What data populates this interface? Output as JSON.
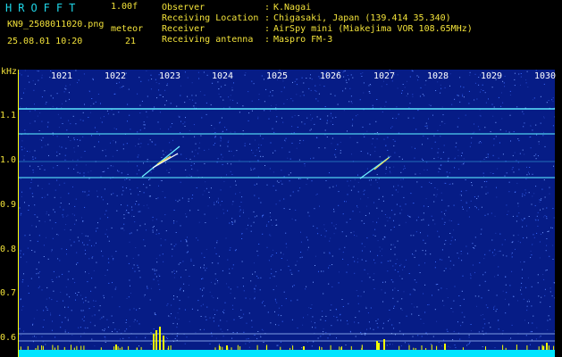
{
  "header": {
    "brand": "HROFFT",
    "version": "1.00f",
    "filename": "KN9_2508011020.png",
    "meteor_label": "meteor",
    "meteor_count": "21",
    "datetime": "25.08.01 10:20",
    "info": [
      {
        "key": "Observer",
        "value": "K.Nagai"
      },
      {
        "key": "Receiving Location",
        "value": "Chigasaki, Japan (139.414 35.340)"
      },
      {
        "key": "Receiver",
        "value": "AirSpy mini (Miakejima VOR 108.65MHz)"
      },
      {
        "key": "Receiving antenna",
        "value": "Maspro FM-3"
      }
    ]
  },
  "spectrogram": {
    "unit": "kHz",
    "time_ticks": [
      "1021",
      "1022",
      "1023",
      "1024",
      "1025",
      "1026",
      "1027",
      "1028",
      "1029",
      "1030"
    ],
    "freq_ticks": [
      "1.1",
      "1.0",
      "0.9",
      "0.8",
      "0.7",
      "0.6"
    ],
    "colors": {
      "background": "#061c86",
      "carrier": "#4de3ff",
      "baseline": "#00e5ff",
      "spike": "#f5ff00"
    }
  }
}
